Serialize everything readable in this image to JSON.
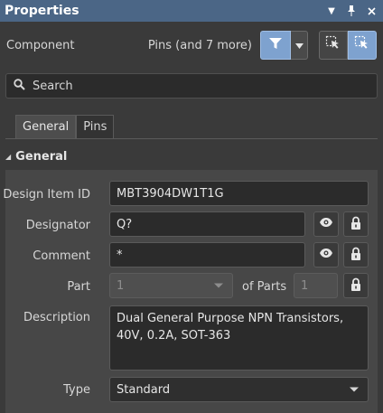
{
  "panel": {
    "title": "Properties"
  },
  "component_row": {
    "label": "Component",
    "filter_summary": "Pins (and 7 more)"
  },
  "search": {
    "placeholder": "Search"
  },
  "tabs": [
    {
      "label": "General"
    },
    {
      "label": "Pins"
    }
  ],
  "section": {
    "title": "General"
  },
  "fields": {
    "design_item_id": {
      "label": "Design Item ID",
      "value": "MBT3904DW1T1G"
    },
    "designator": {
      "label": "Designator",
      "value": "Q?"
    },
    "comment": {
      "label": "Comment",
      "value": "*"
    },
    "part": {
      "label": "Part",
      "value": "1",
      "of_parts_label": "of Parts",
      "of_parts_value": "1"
    },
    "description": {
      "label": "Description",
      "value": "Dual General Purpose NPN Transistors, 40V, 0.2A, SOT-363"
    },
    "type": {
      "label": "Type",
      "value": "Standard"
    }
  },
  "colors": {
    "title_bar": "#4b6686",
    "accent": "#7ea2cf",
    "panel_bg": "#474747",
    "field_bg": "#2b2b2b"
  },
  "icons": [
    "chevron-down-icon",
    "pin-icon",
    "close-icon",
    "filter-icon",
    "select-icon",
    "search-icon",
    "eye-icon",
    "lock-icon"
  ]
}
